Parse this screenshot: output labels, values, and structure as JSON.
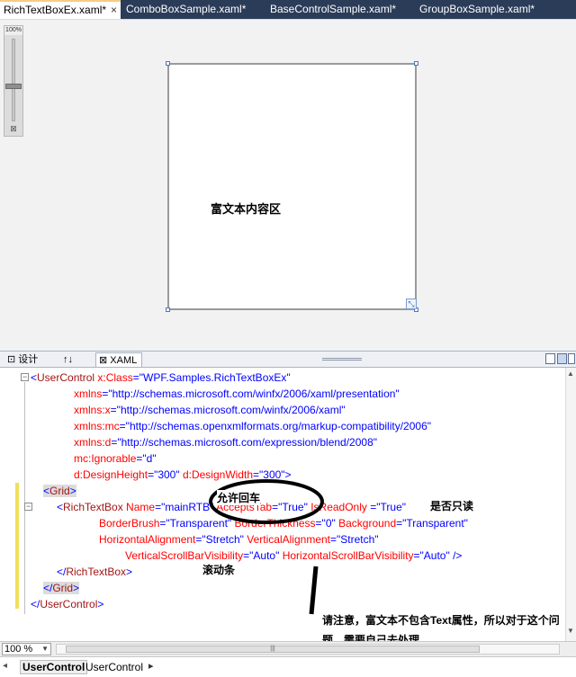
{
  "tabs": [
    {
      "label": "RichTextBoxEx.xaml*",
      "active": true,
      "close": "×"
    },
    {
      "label": "ComboBoxSample.xaml*",
      "active": false
    },
    {
      "label": "BaseControlSample.xaml*",
      "active": false
    },
    {
      "label": "GroupBoxSample.xaml*",
      "active": false
    }
  ],
  "designer": {
    "zoom_label": "100%",
    "zoom_fit_icon": "fit-to-window-icon",
    "content_label": "富文本内容区"
  },
  "split": {
    "design_tab": "设计",
    "swap_icon": "↑↓",
    "xaml_tab": "XAML"
  },
  "code_lines": {
    "l1": {
      "b": "<",
      "t": "UserControl ",
      "a": "x:Class",
      "v": "=\"WPF.Samples.RichTextBoxEx\""
    },
    "l2": {
      "a": "xmlns",
      "v": "=\"http://schemas.microsoft.com/winfx/2006/xaml/presentation\""
    },
    "l3": {
      "a": "xmlns:x",
      "v": "=\"http://schemas.microsoft.com/winfx/2006/xaml\""
    },
    "l4": {
      "a": "xmlns:mc",
      "v": "=\"http://schemas.openxmlformats.org/markup-compatibility/2006\""
    },
    "l5": {
      "a": "xmlns:d",
      "v": "=\"http://schemas.microsoft.com/expression/blend/2008\""
    },
    "l6": {
      "a": "mc:Ignorable",
      "v": "=\"d\""
    },
    "l7": {
      "a1": "d:DesignHeight",
      "v1": "=\"300\" ",
      "a2": "d:DesignWidth",
      "v2": "=\"300\">"
    },
    "l8": {
      "b1": "<",
      "t": "Grid",
      "b2": ">"
    },
    "l9": {
      "b": "<",
      "t": "RichTextBox ",
      "a1": "Name",
      "v1": "=\"mainRTB\" ",
      "a2": "AcceptsTab",
      "v2": "=\"True\" ",
      "a3": "IsReadOnly",
      "v3": " =\"True\""
    },
    "l10": {
      "a1": "BorderBrush",
      "v1": "=\"Transparent\" ",
      "a2": "BorderThickness",
      "v2": "=\"0\" ",
      "a3": "Background",
      "v3": "=\"Transparent\""
    },
    "l11": {
      "a1": "HorizontalAlignment",
      "v1": "=\"Stretch\" ",
      "a2": "VerticalAlignment",
      "v2": "=\"Stretch\""
    },
    "l12": {
      "a1": "VerticalScrollBarVisibility",
      "v1": "=\"Auto\" ",
      "a2": "HorizontalScrollBarVisibility",
      "v2": "=\"Auto\" />"
    },
    "l13": {
      "b1": "</",
      "t": "RichTextBox",
      "b2": ">"
    },
    "l14": {
      "b1": "</",
      "t": "Grid",
      "b2": ">"
    },
    "l15": {
      "b1": "</",
      "t": "UserControl",
      "b2": ">"
    }
  },
  "annotations": {
    "enter": "允许回车",
    "readonly": "是否只读",
    "scroll": "滚动条",
    "note": "请注意，富文本不包含Text属性，所以对于这个问题，需要自己去处理。"
  },
  "bottom": {
    "zoom_value": "100 %",
    "crumb_root": "UserControl",
    "crumb_child": "UserControl"
  },
  "colors": {
    "tab_strip": "#2b3c59",
    "xml_tag": "#a31515",
    "xml_attr": "#ff0000",
    "xml_value": "#0000ff"
  }
}
